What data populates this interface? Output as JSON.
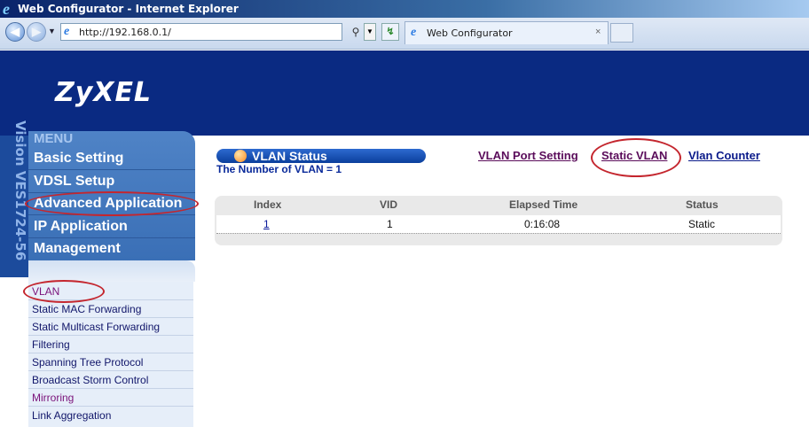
{
  "browser": {
    "window_title": "Web Configurator - Internet Explorer",
    "url": "http://192.168.0.1/",
    "tab_label": "Web Configurator",
    "tab_close": "×"
  },
  "header": {
    "logo": "ZyXEL"
  },
  "sidebar": {
    "device_label": "Vision VES1724-56",
    "menu_title": "MENU",
    "menu": [
      "Basic Setting",
      "VDSL Setup",
      "Advanced Application",
      "IP Application",
      "Management"
    ],
    "submenu": [
      "VLAN",
      "Static MAC Forwarding",
      "Static Multicast Forwarding",
      "Filtering",
      "Spanning Tree Protocol",
      "Broadcast Storm Control",
      "Mirroring",
      "Link Aggregation"
    ]
  },
  "content": {
    "status_title": "VLAN Status",
    "vlan_count": "The Number of VLAN = 1",
    "links": {
      "port_setting": "VLAN Port Setting",
      "static_vlan": "Static VLAN",
      "counter": "Vlan Counter"
    },
    "table": {
      "headers": [
        "Index",
        "VID",
        "Elapsed Time",
        "Status"
      ],
      "rows": [
        [
          "1",
          "1",
          "0:16:08",
          "Static"
        ]
      ]
    }
  },
  "colors": {
    "header_bg": "#0a2a82",
    "annotation": "#c4262e",
    "menu_bg": "#3a6fb6"
  }
}
